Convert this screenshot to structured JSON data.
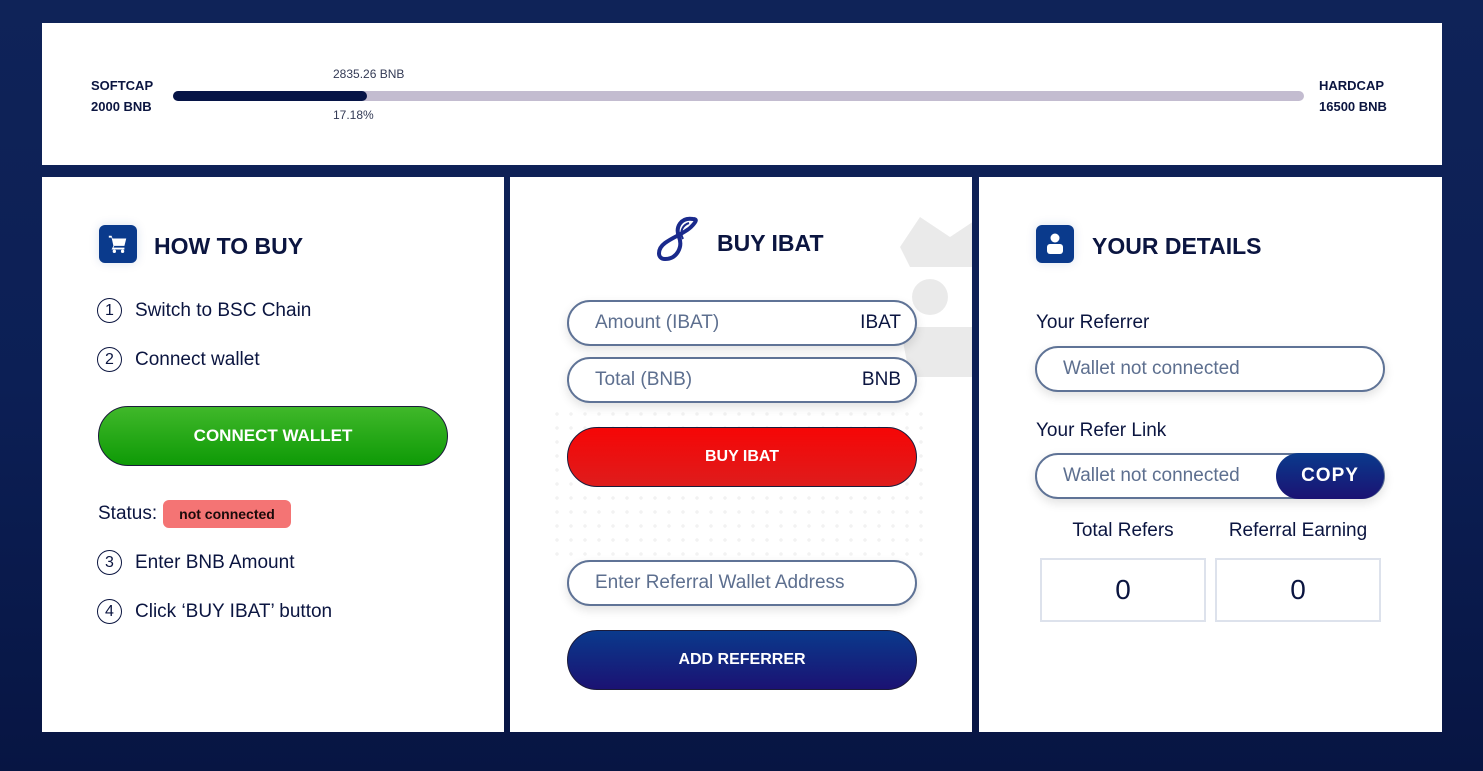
{
  "progress": {
    "softcap_label": "SOFTCAP",
    "softcap_value": "2000 BNB",
    "hardcap_label": "HARDCAP",
    "hardcap_value": "16500 BNB",
    "raised": "2835.26 BNB",
    "percent_text": "17.18%",
    "percent": 17.18
  },
  "how_to_buy": {
    "title": "HOW TO BUY",
    "icon": "cart-icon",
    "steps": [
      {
        "num": "1",
        "text": "Switch to BSC Chain"
      },
      {
        "num": "2",
        "text": "Connect wallet"
      },
      {
        "num": "3",
        "text": "Enter BNB Amount"
      },
      {
        "num": "4",
        "text": "Click ‘BUY IBAT’ button"
      }
    ],
    "connect_button": "CONNECT WALLET",
    "status_label": "Status:",
    "status_value": "not connected"
  },
  "buy": {
    "title": "BUY IBAT",
    "icon": "ibat-logo-icon",
    "amount_placeholder": "Amount (IBAT)",
    "amount_unit": "IBAT",
    "total_placeholder": "Total (BNB)",
    "total_unit": "BNB",
    "buy_button": "BUY IBAT",
    "referral_placeholder": "Enter Referral Wallet Address",
    "add_referrer_button": "ADD REFERRER"
  },
  "details": {
    "title": "YOUR DETAILS",
    "icon": "user-icon",
    "referrer_label": "Your Referrer",
    "referrer_value": "Wallet not connected",
    "refer_link_label": "Your Refer Link",
    "refer_link_value": "Wallet not connected",
    "copy_button": "COPY",
    "total_refers_label": "Total Refers",
    "total_refers_value": "0",
    "referral_earning_label": "Referral Earning",
    "referral_earning_value": "0"
  },
  "colors": {
    "background": "#0c1f55",
    "accent_blue": "#0a3a8c",
    "green": "#0e9a06",
    "red": "#f60606",
    "badge": "#f47474"
  }
}
